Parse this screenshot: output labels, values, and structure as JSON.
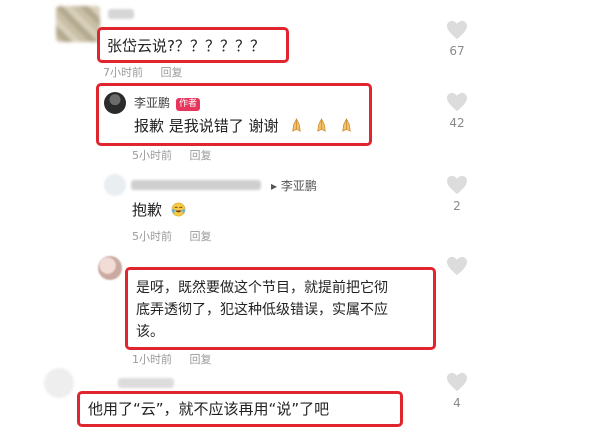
{
  "comments": [
    {
      "text": "张岱云说?？？？？？？",
      "time": "7小时前",
      "reply_label": "回复",
      "likes": "67"
    },
    {
      "author": "李亚鹏",
      "author_tag": "作者",
      "text": "报歉 是我说错了 谢谢",
      "emoji_icons": [
        "praying-hands-icon",
        "praying-hands-icon",
        "praying-hands-icon"
      ],
      "time": "5小时前",
      "reply_label": "回复",
      "likes": "42"
    },
    {
      "reply_to_prefix": "▸",
      "reply_to": "李亚鹏",
      "text": "抱歉",
      "emoji_icons": [
        "tears-of-joy-icon"
      ],
      "time": "5小时前",
      "reply_label": "回复",
      "likes": "2"
    },
    {
      "text_line1": "是呀，既然要做这个节目，就提前把它彻",
      "text_line2": "底弄透彻了，犯这种低级错误，实属不应",
      "text_line3": "该。",
      "time": "1小时前",
      "reply_label": "回复",
      "likes": ""
    },
    {
      "text": "他用了“云”，就不应该再用“说”了吧",
      "likes": "4"
    }
  ],
  "colors": {
    "highlight_border": "#e0252e",
    "meta_text": "#9a9a9a",
    "author_tag_bg": "#e8355d"
  }
}
